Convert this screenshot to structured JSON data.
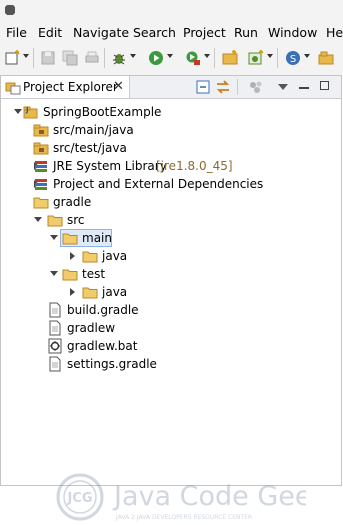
{
  "menu": [
    "File",
    "Edit",
    "Navigate",
    "Search",
    "Project",
    "Run",
    "Window",
    "He"
  ],
  "view": {
    "tab_label": "Project Explorer"
  },
  "tree": [
    {
      "label": "SpringBootExample",
      "decoration": "",
      "icon": "java-project-icon"
    },
    {
      "label": "src/main/java",
      "decoration": "",
      "icon": "source-folder-icon"
    },
    {
      "label": "src/test/java",
      "decoration": "",
      "icon": "source-folder-icon"
    },
    {
      "label": "JRE System Library",
      "decoration": "[jre1.8.0_45]",
      "icon": "library-icon"
    },
    {
      "label": "Project and External Dependencies",
      "decoration": "",
      "icon": "library-icon"
    },
    {
      "label": "gradle",
      "decoration": "",
      "icon": "folder-icon"
    },
    {
      "label": "src",
      "decoration": "",
      "icon": "folder-icon"
    },
    {
      "label": "main",
      "decoration": "",
      "icon": "folder-icon"
    },
    {
      "label": "java",
      "decoration": "",
      "icon": "folder-icon"
    },
    {
      "label": "test",
      "decoration": "",
      "icon": "folder-icon"
    },
    {
      "label": "java",
      "decoration": "",
      "icon": "folder-icon"
    },
    {
      "label": "build.gradle",
      "decoration": "",
      "icon": "file-icon"
    },
    {
      "label": "gradlew",
      "decoration": "",
      "icon": "file-icon"
    },
    {
      "label": "gradlew.bat",
      "decoration": "",
      "icon": "bat-file-icon"
    },
    {
      "label": "settings.gradle",
      "decoration": "",
      "icon": "file-icon"
    }
  ],
  "watermark": {
    "logo_text": "JCG",
    "brand": "Java Code Geeks",
    "tagline": "JAVA 2 JAVA DEVELOPERS RESOURCE CENTER"
  },
  "colors": {
    "selection": "#dfeaf8",
    "folder": "#e8b94a",
    "decoration": "#8a6a32"
  }
}
